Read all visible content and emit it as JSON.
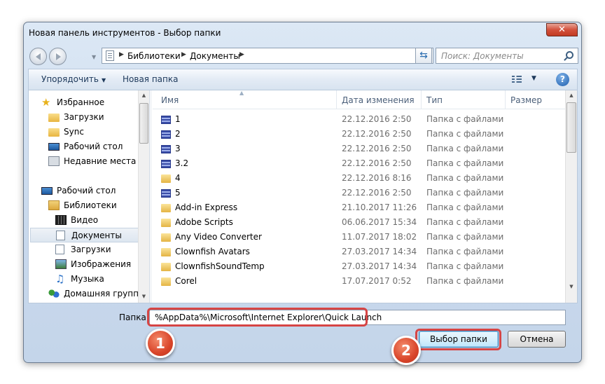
{
  "window": {
    "title": "Новая панель инструментов - Выбор папки",
    "close_glyph": "✕"
  },
  "addressbar": {
    "crumbs": [
      "Библиотеки",
      "Документы"
    ],
    "search_placeholder": "Поиск: Документы"
  },
  "toolbar": {
    "organize_label": "Упорядочить",
    "new_folder_label": "Новая папка",
    "help_glyph": "?"
  },
  "nav": {
    "items": [
      {
        "label": "Избранное",
        "icon": "star-icon"
      },
      {
        "label": "Загрузки",
        "icon": "downloads-folder-icon"
      },
      {
        "label": "Sync",
        "icon": "folder-icon"
      },
      {
        "label": "Рабочий стол",
        "icon": "desktop-icon"
      },
      {
        "label": "Недавние места",
        "icon": "recent-places-icon"
      },
      {
        "label": "Рабочий стол",
        "icon": "desktop-icon"
      },
      {
        "label": "Библиотеки",
        "icon": "libraries-icon"
      },
      {
        "label": "Видео",
        "icon": "video-library-icon"
      },
      {
        "label": "Документы",
        "icon": "documents-library-icon"
      },
      {
        "label": "Загрузки",
        "icon": "downloads-library-icon"
      },
      {
        "label": "Изображения",
        "icon": "pictures-library-icon"
      },
      {
        "label": "Музыка",
        "icon": "music-library-icon"
      },
      {
        "label": "Домашняя группа",
        "icon": "homegroup-icon"
      }
    ]
  },
  "columns": {
    "name": "Имя",
    "date": "Дата изменения",
    "type": "Тип",
    "size": "Размер"
  },
  "files": [
    {
      "name": "1",
      "date": "22.12.2016 2:50",
      "type": "Папка с файлами",
      "icon": "stacked-folder-icon"
    },
    {
      "name": "2",
      "date": "22.12.2016 2:50",
      "type": "Папка с файлами",
      "icon": "stacked-folder-icon"
    },
    {
      "name": "3",
      "date": "22.12.2016 2:50",
      "type": "Папка с файлами",
      "icon": "stacked-folder-icon"
    },
    {
      "name": "3.2",
      "date": "22.12.2016 2:50",
      "type": "Папка с файлами",
      "icon": "stacked-folder-icon"
    },
    {
      "name": "4",
      "date": "22.12.2016 8:16",
      "type": "Папка с файлами",
      "icon": "folder-icon"
    },
    {
      "name": "5",
      "date": "22.12.2016 2:50",
      "type": "Папка с файлами",
      "icon": "stacked-folder-icon"
    },
    {
      "name": "Add-in Express",
      "date": "21.10.2017 11:26",
      "type": "Папка с файлами",
      "icon": "folder-icon"
    },
    {
      "name": "Adobe Scripts",
      "date": "06.06.2017 15:34",
      "type": "Папка с файлами",
      "icon": "folder-icon"
    },
    {
      "name": "Any Video Converter",
      "date": "11.07.2017 18:02",
      "type": "Папка с файлами",
      "icon": "folder-icon"
    },
    {
      "name": "Clownfish Avatars",
      "date": "27.03.2017 14:34",
      "type": "Папка с файлами",
      "icon": "folder-icon"
    },
    {
      "name": "ClownfishSoundTemp",
      "date": "27.03.2017 14:34",
      "type": "Папка с файлами",
      "icon": "folder-icon"
    },
    {
      "name": "Corel",
      "date": "17.07.2017 0:52",
      "type": "Папка с файлами",
      "icon": "folder-icon"
    }
  ],
  "footer": {
    "folder_label": "Папка:",
    "folder_value": "%AppData%\\Microsoft\\Internet Explorer\\Quick Launch",
    "select_button": "Выбор папки",
    "cancel_button": "Отмена"
  },
  "annotations": {
    "badge1": "1",
    "badge2": "2",
    "highlight_color": "#d64545"
  }
}
